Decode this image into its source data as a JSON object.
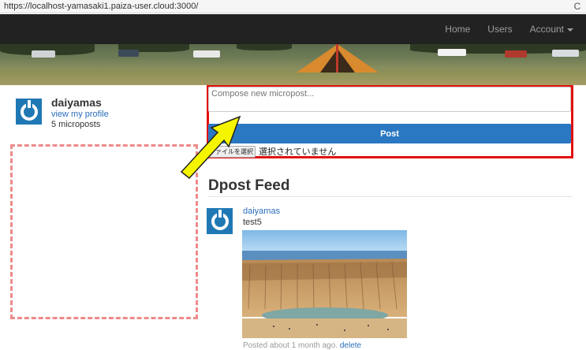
{
  "browser": {
    "url": "https://localhost-yamasaki1.paiza-user.cloud:3000/",
    "reload_icon": "C"
  },
  "navbar": {
    "links": [
      "Home",
      "Users",
      "Account"
    ]
  },
  "profile": {
    "name": "daiyamas",
    "view_profile": "view my profile",
    "micropost_count": "5 microposts"
  },
  "compose": {
    "placeholder": "Compose new micropost...",
    "post_label": "Post",
    "file_button": "ファイルを選択",
    "file_status": "選択されていません"
  },
  "feed": {
    "title": "Dpost Feed",
    "items": [
      {
        "user": "daiyamas",
        "content": "test5",
        "meta": "Posted about 1 month ago.",
        "delete_label": "delete"
      }
    ]
  },
  "colors": {
    "navbar_bg": "#222222",
    "primary": "#2a78c2",
    "annotation_box": "#e21010",
    "annotation_dashed": "#ef8a8a",
    "annotation_arrow": "#f5f500"
  }
}
